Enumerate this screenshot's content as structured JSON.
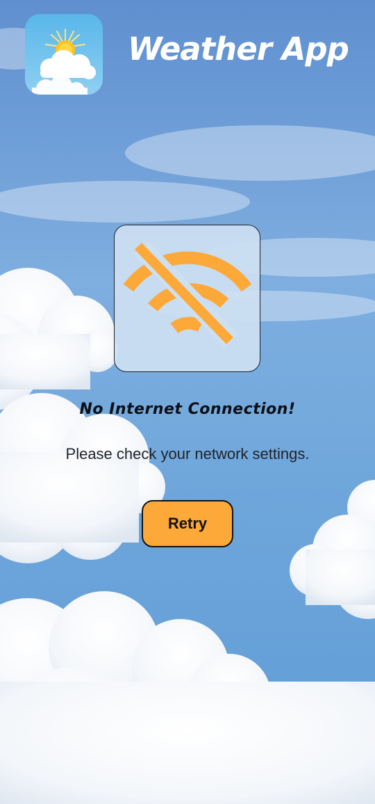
{
  "header": {
    "app_title": "Weather App",
    "app_icon": "sun-cloud-icon"
  },
  "error": {
    "icon": "wifi-off-icon",
    "title": "No Internet Connection!",
    "message": "Please check your network settings.",
    "retry_label": "Retry"
  },
  "colors": {
    "accent": "#fca93a",
    "sky": "#6fa7db",
    "title_text": "#ffffff",
    "body_text": "#1f2228"
  }
}
